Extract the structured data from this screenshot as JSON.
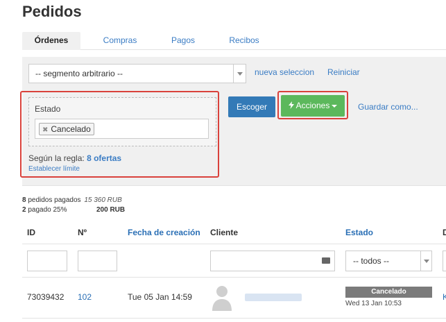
{
  "page": {
    "title": "Pedidos"
  },
  "tabs": [
    {
      "label": "Órdenes",
      "active": true
    },
    {
      "label": "Compras",
      "active": false
    },
    {
      "label": "Pagos",
      "active": false
    },
    {
      "label": "Recibos",
      "active": false
    }
  ],
  "segment": {
    "selected": "-- segmento arbitrario --",
    "new_selection_link": "nueva seleccion",
    "reset_link": "Reiniciar"
  },
  "filter": {
    "estado_label": "Estado",
    "estado_tag": "Cancelado",
    "rule_prefix": "Según la regla:",
    "rule_link": "8 ofertas",
    "limit_link": "Establecer límite"
  },
  "actions": {
    "choose_button": "Escoger",
    "actions_button": "Acciones",
    "save_as_link": "Guardar como..."
  },
  "summary": {
    "paid_orders_count": "8",
    "paid_orders_label": "pedidos pagados",
    "paid_orders_amount": "15 360 RUB",
    "partial_count": "2",
    "partial_label": "pagado 25%",
    "partial_amount": "200 RUB"
  },
  "table": {
    "headers": [
      "ID",
      "Nº",
      "Fecha de creación",
      "Cliente",
      "Estado",
      "D"
    ],
    "estado_filter_value": "-- todos --",
    "rows": [
      {
        "id": "73039432",
        "number": "102",
        "created": "Tue 05 Jan 14:59",
        "status": "Cancelado",
        "status_date": "Wed 13 Jan 10:53",
        "next_col": "K"
      }
    ]
  },
  "colors": {
    "link": "#3a7cc4",
    "primary_button": "#337ab7",
    "success_button": "#5cb85c",
    "highlight_border": "#d9413b",
    "status_badge": "#7b7b7b"
  }
}
